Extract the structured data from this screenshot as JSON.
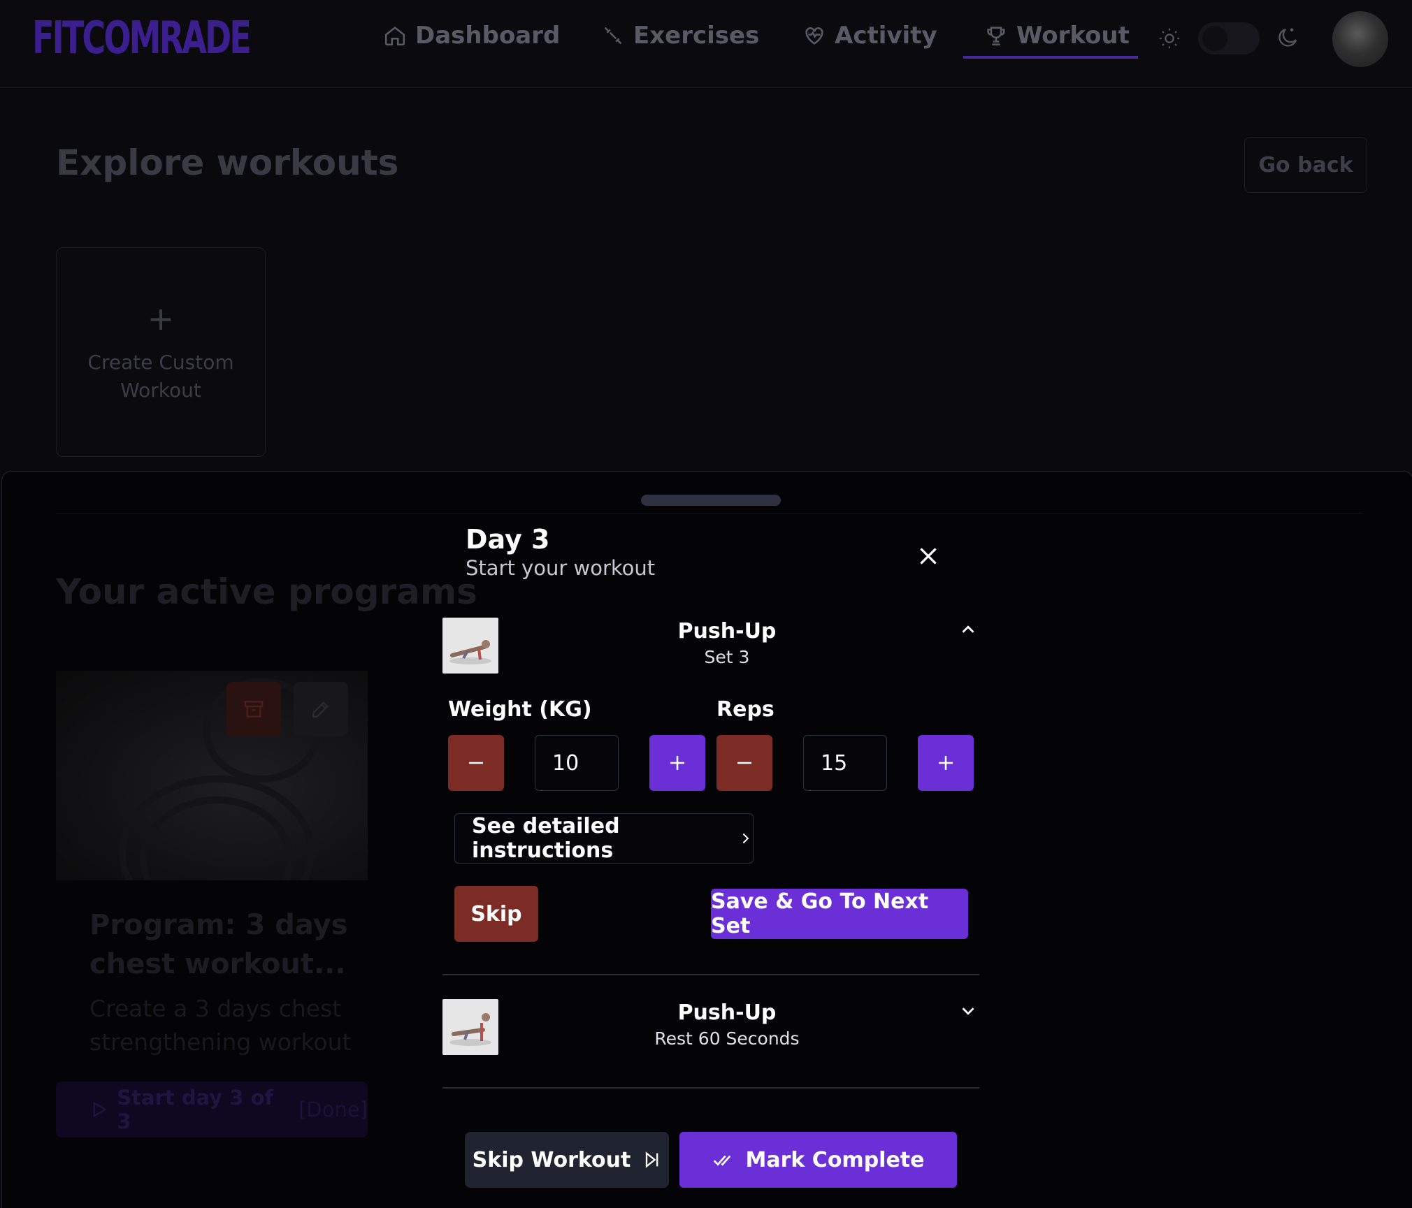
{
  "brand": {
    "logo_text": "FITCOMRADE"
  },
  "nav": {
    "items": [
      {
        "label": "Dashboard",
        "icon": "home-icon"
      },
      {
        "label": "Exercises",
        "icon": "dumbbell-icon"
      },
      {
        "label": "Activity",
        "icon": "heart-pulse-icon"
      },
      {
        "label": "Workout",
        "icon": "trophy-icon",
        "active": true
      }
    ],
    "theme_toggle": {
      "light_icon": "sun-icon",
      "dark_icon": "moon-icon"
    }
  },
  "page": {
    "title": "Explore workouts",
    "go_back_label": "Go back",
    "create_card": {
      "plus": "+",
      "label": "Create Custom Workout"
    },
    "active_title": "Your active programs",
    "program": {
      "title": "Program: 3 days chest workout...",
      "description": "Create a 3 days chest strengthening workout",
      "start_label": "Start day 3 of 3",
      "start_status": "[Done]"
    }
  },
  "drawer": {
    "title": "Day 3",
    "subtitle": "Start your workout",
    "exercises": [
      {
        "name": "Push-Up",
        "detail": "Set 3",
        "expanded": true,
        "weight_label": "Weight (KG)",
        "weight_value": "10",
        "reps_label": "Reps",
        "reps_value": "15",
        "instructions_label": "See detailed instructions",
        "skip_label": "Skip",
        "next_label": "Save & Go To Next Set"
      },
      {
        "name": "Push-Up",
        "detail": "Rest 60 Seconds",
        "expanded": false
      }
    ],
    "skip_workout_label": "Skip Workout",
    "mark_complete_label": "Mark Complete"
  },
  "colors": {
    "accent": "#6a2fd6",
    "danger": "#7c2b25",
    "background": "#0a0a0e",
    "sheet": "#040406"
  }
}
